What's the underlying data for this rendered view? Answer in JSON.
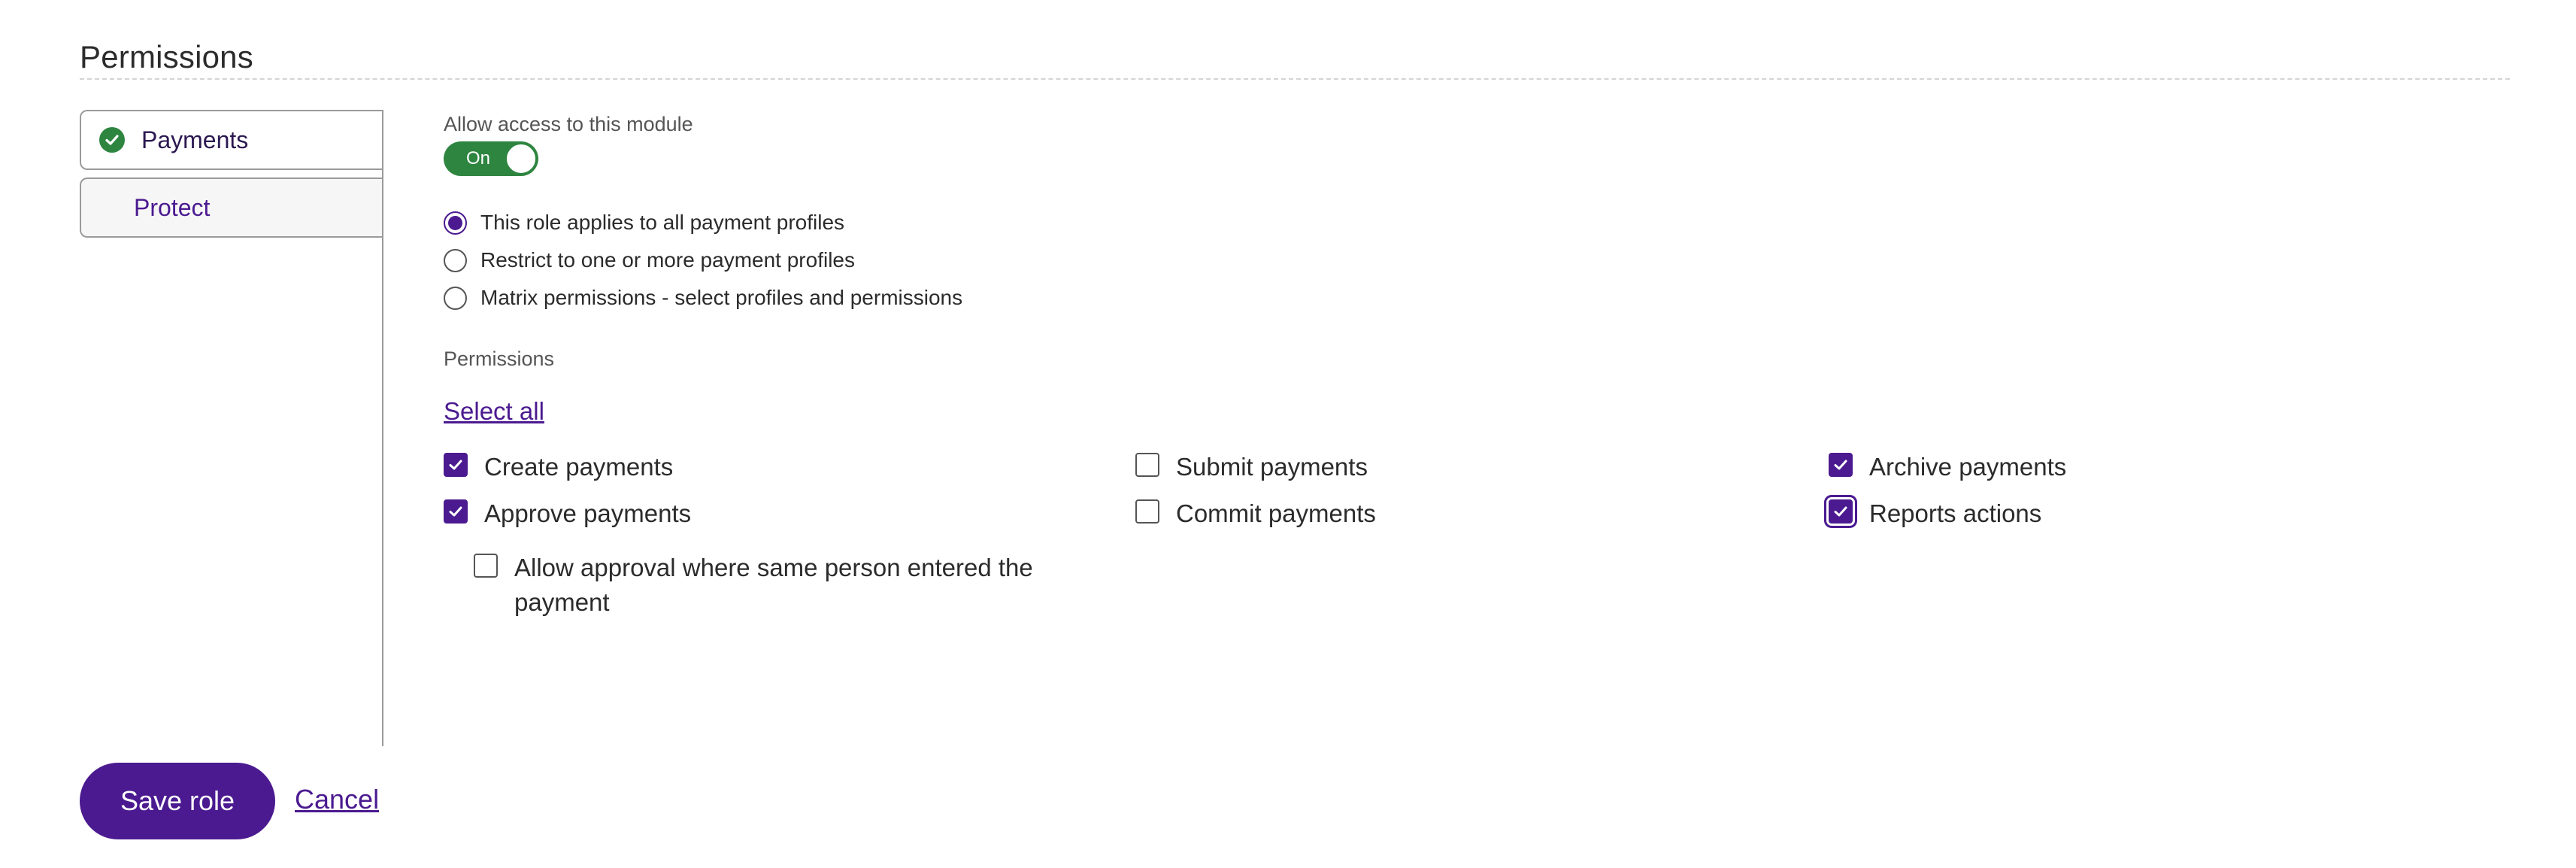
{
  "section": {
    "title": "Permissions"
  },
  "modules": [
    {
      "label": "Payments",
      "active": true,
      "status_icon": "check-circle-icon"
    },
    {
      "label": "Protect",
      "active": false
    }
  ],
  "access": {
    "label": "Allow access to this module",
    "toggle_text": "On",
    "toggle_on": true
  },
  "scope": {
    "options": [
      {
        "label": "This role applies to all payment profiles",
        "selected": true
      },
      {
        "label": "Restrict to one or more payment profiles",
        "selected": false
      },
      {
        "label": "Matrix permissions - select profiles and permissions",
        "selected": false
      }
    ]
  },
  "permissions": {
    "heading": "Permissions",
    "select_all": "Select all",
    "items": [
      {
        "label": "Create payments",
        "checked": true
      },
      {
        "label": "Approve payments",
        "checked": true
      },
      {
        "label": "Allow approval where same person entered the payment",
        "checked": false
      },
      {
        "label": "Submit payments",
        "checked": false
      },
      {
        "label": "Commit payments",
        "checked": false
      },
      {
        "label": "Archive payments",
        "checked": true
      },
      {
        "label": "Reports actions",
        "checked": true,
        "focused": true
      }
    ]
  },
  "actions": {
    "save_label": "Save role",
    "cancel_label": "Cancel"
  },
  "colors": {
    "accent": "#4b1a90",
    "success": "#2e8540",
    "text": "#2b2b2b",
    "muted": "#555555"
  }
}
